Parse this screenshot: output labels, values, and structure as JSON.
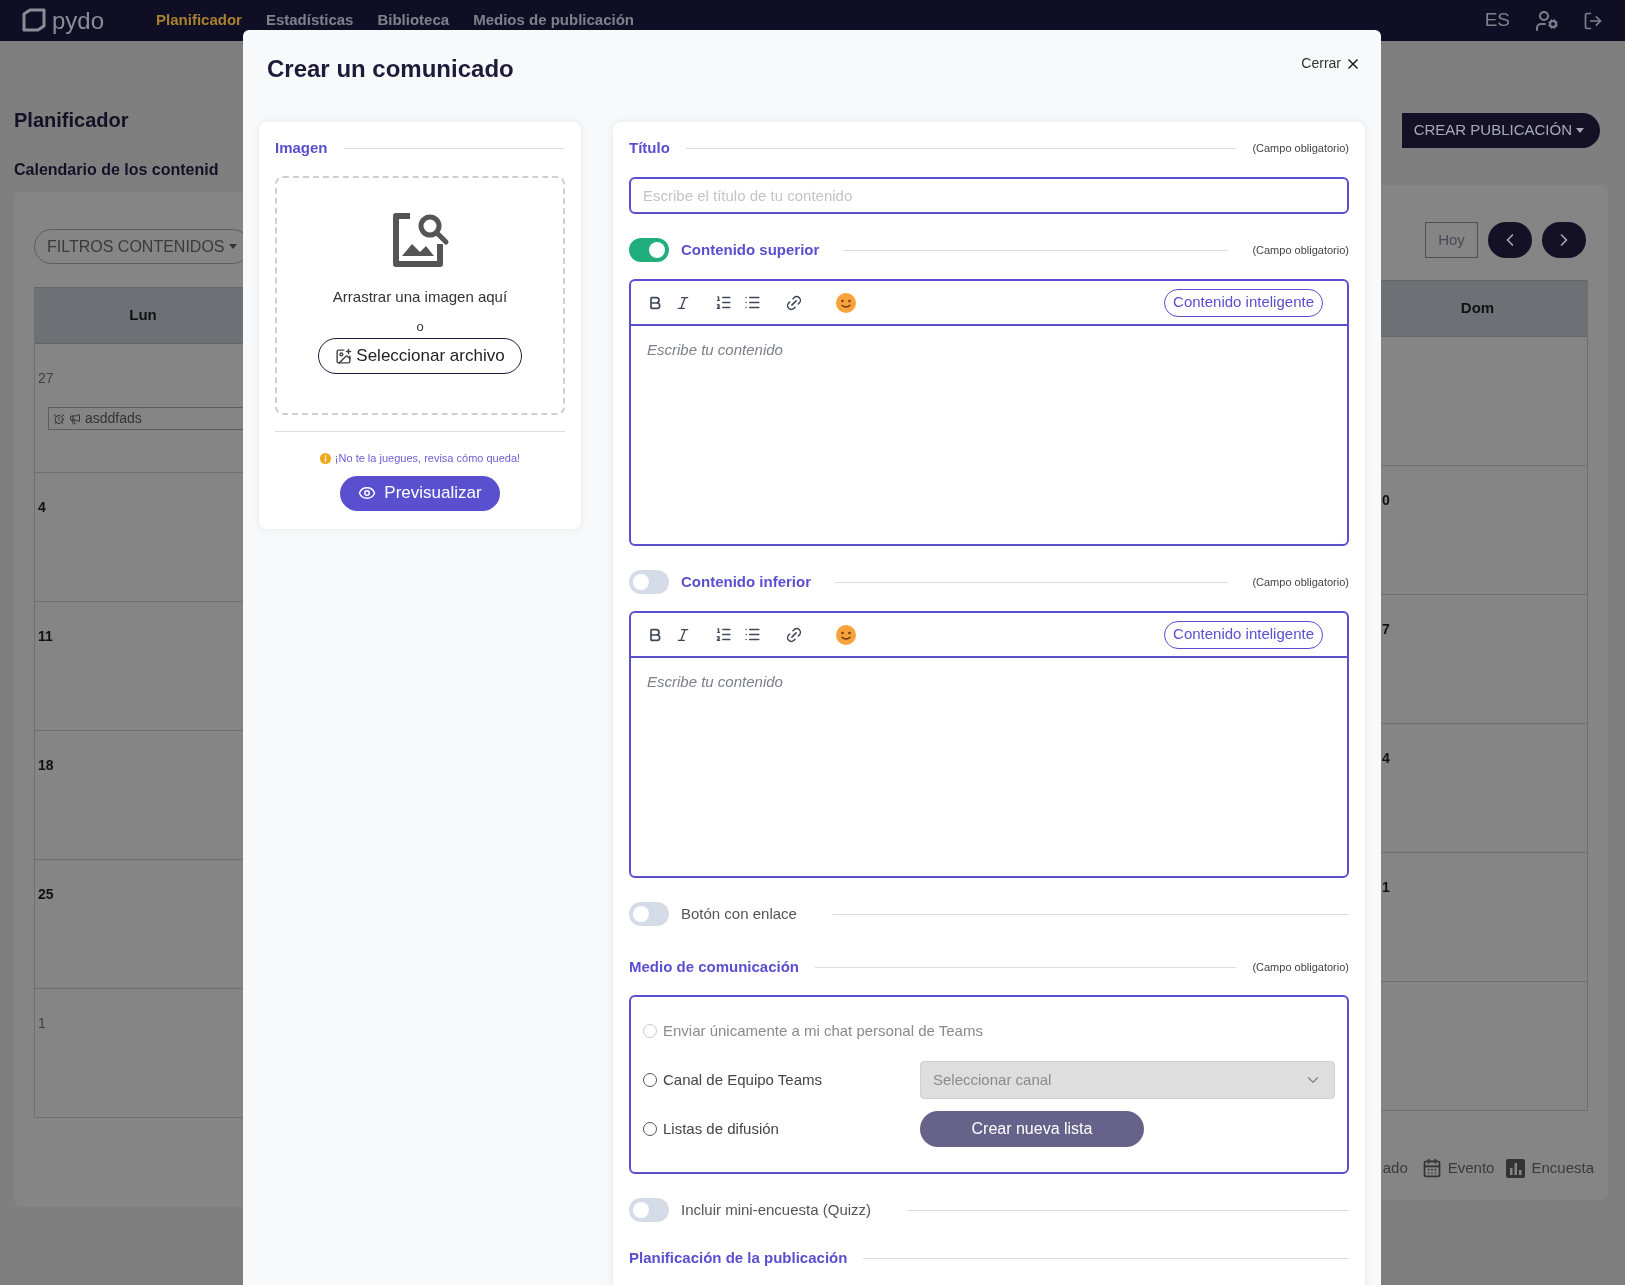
{
  "navbar": {
    "logo": "pydo",
    "links": [
      {
        "label": "Planificador",
        "selected": true
      },
      {
        "label": "Estadísticas",
        "selected": false
      },
      {
        "label": "Biblioteca",
        "selected": false
      },
      {
        "label": "Medios de publicación",
        "selected": false
      }
    ],
    "language": "ES"
  },
  "page": {
    "title": "Planificador",
    "subtitle": "Calendario de los contenid",
    "create_button": "CREAR PUBLICACIÓN",
    "filter_button": "FILTROS CONTENIDOS",
    "today_button": "Hoy",
    "calendar": {
      "left_header": "Lun",
      "right_header": "Dom",
      "left_rows": [
        {
          "date": "27",
          "in_month": false,
          "events": [
            {
              "title": "asddfads"
            }
          ]
        },
        {
          "date": "4",
          "in_month": true,
          "events": []
        },
        {
          "date": "11",
          "in_month": true,
          "events": []
        },
        {
          "date": "18",
          "in_month": true,
          "events": []
        },
        {
          "date": "25",
          "in_month": true,
          "events": []
        },
        {
          "date": "1",
          "in_month": false,
          "events": []
        }
      ],
      "right_fragments": [
        "0",
        "7",
        "4",
        "1"
      ]
    },
    "legend": [
      {
        "kind": "plain",
        "label": "ado"
      },
      {
        "kind": "event",
        "label": "Evento"
      },
      {
        "kind": "poll",
        "label": "Encuesta"
      }
    ]
  },
  "modal": {
    "title": "Crear un comunicado",
    "close_label": "Cerrar",
    "image_panel": {
      "heading": "Imagen",
      "drop_text": "Arrastrar una imagen aquí",
      "or_text": "o",
      "select_button": "Seleccionar archivo",
      "hint": "¡No te la juegues, revisa cómo queda!",
      "preview_button": "Previsualizar"
    },
    "title_field": {
      "label": "Título",
      "required_note": "(Campo obligatorio)",
      "placeholder": "Escribe el título de tu contenido"
    },
    "sections": [
      {
        "kind": "editor",
        "label": "Contenido superior",
        "on": true,
        "required_note": "(Campo obligatorio)",
        "smart_button": "Contenido inteligente",
        "placeholder": "Escribe tu contenido"
      },
      {
        "kind": "editor",
        "label": "Contenido inferior",
        "on": false,
        "required_note": "(Campo obligatorio)",
        "smart_button": "Contenido inteligente",
        "placeholder": "Escribe tu contenido"
      },
      {
        "kind": "toggle",
        "label": "Botón con enlace",
        "on": false
      },
      {
        "kind": "channels",
        "label": "Medio de comunicación",
        "required_note": "(Campo obligatorio)",
        "options": [
          {
            "label": "Enviar únicamente a mi chat personal de Teams",
            "selected": false,
            "disabled": true
          },
          {
            "label": "Canal de Equipo Teams",
            "selected": false,
            "disabled": false,
            "control": {
              "kind": "select",
              "placeholder": "Seleccionar canal"
            }
          },
          {
            "label": "Listas de difusión",
            "selected": false,
            "disabled": false,
            "control": {
              "kind": "button",
              "label": "Crear nueva lista"
            }
          }
        ]
      },
      {
        "kind": "toggle",
        "label": "Incluir mini-encuesta (Quizz)",
        "on": false
      },
      {
        "kind": "heading",
        "label": "Planificación de la publicación"
      }
    ]
  }
}
